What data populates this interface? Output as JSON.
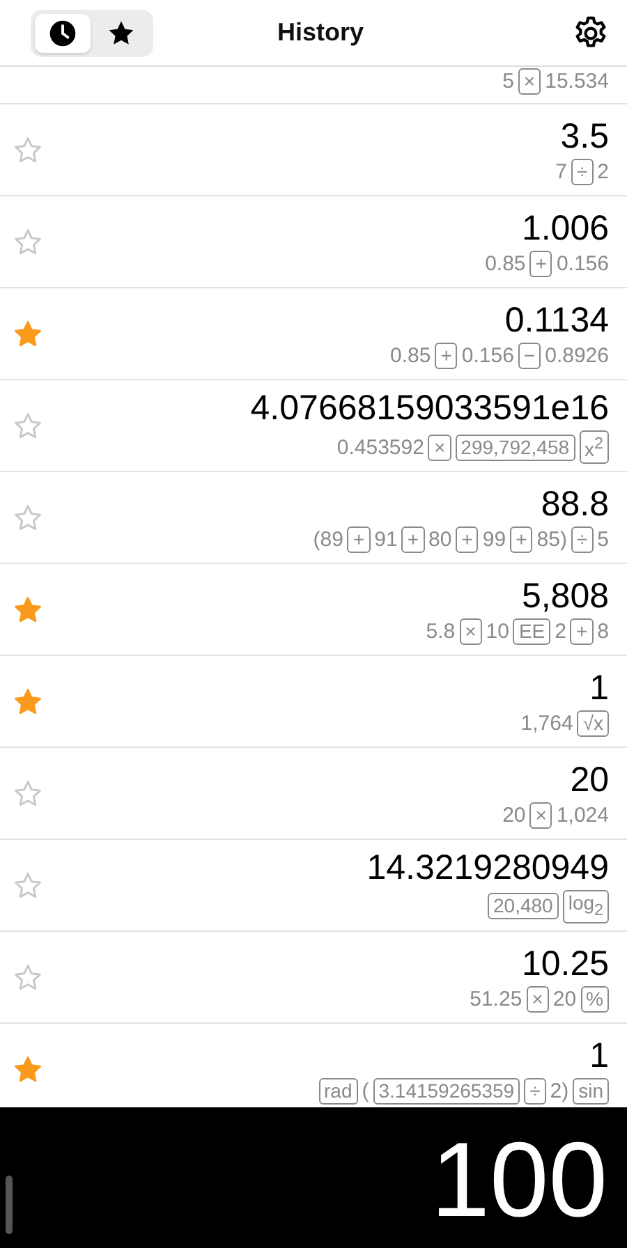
{
  "header": {
    "title": "History",
    "tabs": [
      {
        "kind": "clock",
        "selected": true
      },
      {
        "kind": "star",
        "selected": false
      }
    ]
  },
  "rows": [
    {
      "expression": [
        {
          "kind": "text",
          "text": "5"
        },
        {
          "kind": "key",
          "text": "×"
        },
        {
          "kind": "text",
          "text": "15.534"
        }
      ]
    },
    {
      "starred": false,
      "result": "3.5",
      "expression": [
        {
          "kind": "text",
          "text": "7"
        },
        {
          "kind": "key",
          "text": "÷"
        },
        {
          "kind": "text",
          "text": "2"
        }
      ]
    },
    {
      "starred": false,
      "result": "1.006",
      "expression": [
        {
          "kind": "text",
          "text": "0.85"
        },
        {
          "kind": "key",
          "text": "+"
        },
        {
          "kind": "text",
          "text": "0.156"
        }
      ]
    },
    {
      "starred": true,
      "result": "0.1134",
      "expression": [
        {
          "kind": "text",
          "text": "0.85"
        },
        {
          "kind": "key",
          "text": "+"
        },
        {
          "kind": "text",
          "text": "0.156"
        },
        {
          "kind": "key",
          "text": "−"
        },
        {
          "kind": "text",
          "text": "0.8926"
        }
      ]
    },
    {
      "starred": false,
      "result": "4.07668159033591e16",
      "expression": [
        {
          "kind": "text",
          "text": "0.453592"
        },
        {
          "kind": "key",
          "text": "×"
        },
        {
          "kind": "key",
          "text": "299,792,458"
        },
        {
          "kind": "key",
          "text": "x$^{2}$"
        }
      ]
    },
    {
      "starred": false,
      "result": "88.8",
      "expression": [
        {
          "kind": "text",
          "text": "(89"
        },
        {
          "kind": "key",
          "text": "+"
        },
        {
          "kind": "text",
          "text": "91"
        },
        {
          "kind": "key",
          "text": "+"
        },
        {
          "kind": "text",
          "text": "80"
        },
        {
          "kind": "key",
          "text": "+"
        },
        {
          "kind": "text",
          "text": "99"
        },
        {
          "kind": "key",
          "text": "+"
        },
        {
          "kind": "text",
          "text": "85)"
        },
        {
          "kind": "key",
          "text": "÷"
        },
        {
          "kind": "text",
          "text": "5"
        }
      ]
    },
    {
      "starred": true,
      "result": "5,808",
      "expression": [
        {
          "kind": "text",
          "text": "5.8"
        },
        {
          "kind": "key",
          "text": "×"
        },
        {
          "kind": "text",
          "text": "10"
        },
        {
          "kind": "key",
          "text": "EE"
        },
        {
          "kind": "text",
          "text": "2"
        },
        {
          "kind": "key",
          "text": "+"
        },
        {
          "kind": "text",
          "text": "8"
        }
      ]
    },
    {
      "starred": true,
      "result": "1",
      "expression": [
        {
          "kind": "text",
          "text": "1,764"
        },
        {
          "kind": "key",
          "text": "√x"
        }
      ]
    },
    {
      "starred": false,
      "result": "20",
      "expression": [
        {
          "kind": "text",
          "text": "20"
        },
        {
          "kind": "key",
          "text": "×"
        },
        {
          "kind": "text",
          "text": "1,024"
        }
      ]
    },
    {
      "starred": false,
      "result": "14.3219280949",
      "expression": [
        {
          "kind": "key",
          "text": "20,480"
        },
        {
          "kind": "key",
          "text": "log$_{2}$"
        }
      ]
    },
    {
      "starred": false,
      "result": "10.25",
      "expression": [
        {
          "kind": "text",
          "text": "51.25"
        },
        {
          "kind": "key",
          "text": "×"
        },
        {
          "kind": "text",
          "text": "20"
        },
        {
          "kind": "key",
          "text": "%"
        }
      ]
    },
    {
      "starred": true,
      "result": "1",
      "expression": [
        {
          "kind": "key",
          "text": "rad"
        },
        {
          "kind": "text",
          "text": "("
        },
        {
          "kind": "key",
          "text": "3.14159265359"
        },
        {
          "kind": "key",
          "text": "÷"
        },
        {
          "kind": "text",
          "text": "2)"
        },
        {
          "kind": "key",
          "text": "sin"
        }
      ]
    }
  ],
  "display": {
    "value": "100"
  }
}
